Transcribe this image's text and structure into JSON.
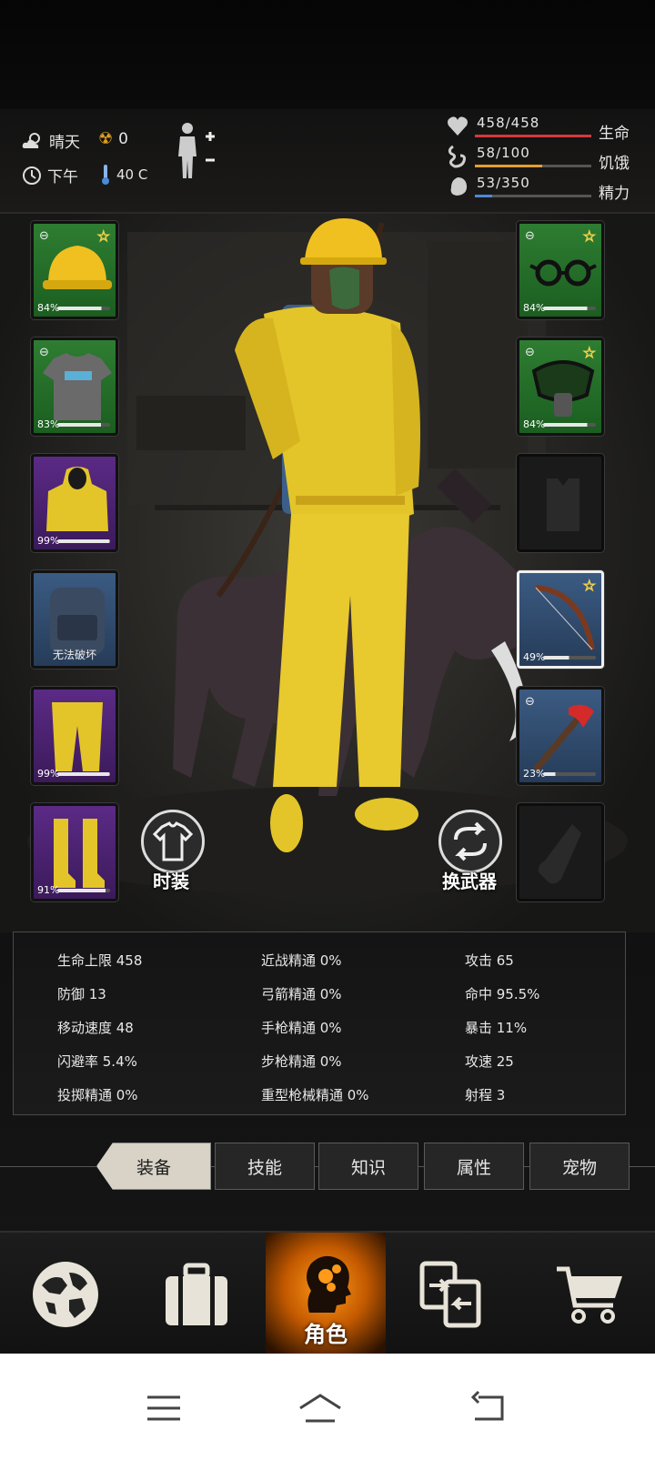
{
  "header": {
    "weather": "晴天",
    "radiation": "0",
    "time": "下午",
    "temperature": "40 C",
    "vitals": [
      {
        "name": "生命",
        "value": "458/458",
        "fill": 1.0,
        "color": "#d23a3a",
        "icon": "heart-icon"
      },
      {
        "name": "饥饿",
        "value": "58/100",
        "fill": 0.58,
        "color": "#e0a030",
        "icon": "stomach-icon"
      },
      {
        "name": "精力",
        "value": "53/350",
        "fill": 0.15,
        "color": "#4a8ad6",
        "icon": "lungs-icon"
      }
    ]
  },
  "equipment": {
    "left": [
      {
        "item": "helmet-icon",
        "rarity": "green",
        "durability": "84%",
        "durability_fill": 0.84,
        "starred": true,
        "linked": true
      },
      {
        "item": "tshirt-icon",
        "rarity": "green",
        "durability": "83%",
        "durability_fill": 0.83,
        "starred": false,
        "linked": true
      },
      {
        "item": "hazmat-jacket-icon",
        "rarity": "purple",
        "durability": "99%",
        "durability_fill": 0.99,
        "starred": false,
        "linked": false
      },
      {
        "item": "backpack-icon",
        "rarity": "blue",
        "durability": "无法破坏",
        "durability_fill": null,
        "starred": false,
        "linked": false
      },
      {
        "item": "hazmat-pants-icon",
        "rarity": "purple",
        "durability": "99%",
        "durability_fill": 0.99,
        "starred": false,
        "linked": false
      },
      {
        "item": "rubber-boots-icon",
        "rarity": "purple",
        "durability": "91%",
        "durability_fill": 0.91,
        "starred": false,
        "linked": false
      }
    ],
    "right": [
      {
        "item": "glasses-icon",
        "rarity": "green",
        "durability": "84%",
        "durability_fill": 0.84,
        "starred": true,
        "linked": true
      },
      {
        "item": "gas-mask-icon",
        "rarity": "green",
        "durability": "84%",
        "durability_fill": 0.84,
        "starred": true,
        "linked": true
      },
      {
        "item": "vest-slot-icon",
        "rarity": "empty",
        "durability": "",
        "durability_fill": null,
        "starred": false,
        "linked": false
      },
      {
        "item": "bow-icon",
        "rarity": "blue",
        "durability": "49%",
        "durability_fill": 0.49,
        "starred": true,
        "linked": false,
        "selected": true
      },
      {
        "item": "fire-axe-icon",
        "rarity": "blue",
        "durability": "23%",
        "durability_fill": 0.23,
        "starred": false,
        "linked": true
      },
      {
        "item": "bottle-slot-icon",
        "rarity": "empty",
        "durability": "",
        "durability_fill": null,
        "starred": false,
        "linked": false
      }
    ],
    "fashion_label": "时装",
    "switch_weapon_label": "换武器"
  },
  "stats": [
    [
      "生命上限 458",
      "近战精通 0%",
      "攻击 65"
    ],
    [
      "防御 13",
      "弓箭精通 0%",
      "命中 95.5%"
    ],
    [
      "移动速度 48",
      "手枪精通 0%",
      "暴击 11%"
    ],
    [
      "闪避率 5.4%",
      "步枪精通 0%",
      "攻速 25"
    ],
    [
      "投掷精通 0%",
      "重型枪械精通 0%",
      "射程 3"
    ]
  ],
  "tabs": [
    "装备",
    "技能",
    "知识",
    "属性",
    "宠物"
  ],
  "nav": {
    "items": [
      "globe-icon",
      "suitcase-icon",
      "character-icon",
      "trade-icon",
      "cart-icon"
    ],
    "active_label": "角色"
  },
  "system": [
    "menu-icon",
    "home-icon",
    "back-icon"
  ]
}
